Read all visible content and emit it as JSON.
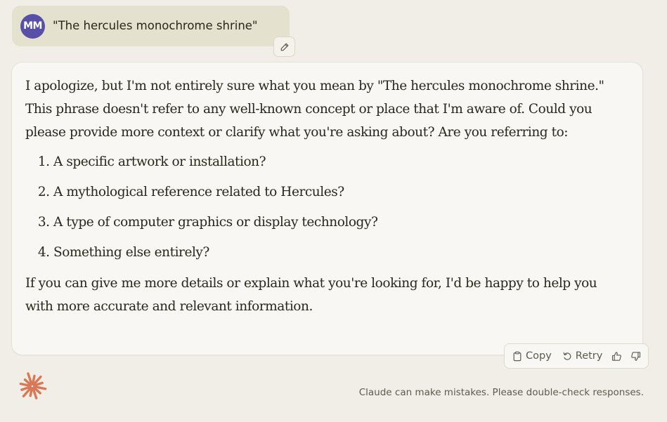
{
  "user_message": {
    "avatar_initials": "MM",
    "text": "\"The hercules monochrome shrine\""
  },
  "assistant_message": {
    "intro": "I apologize, but I'm not entirely sure what you mean by \"The hercules monochrome shrine.\" This phrase doesn't refer to any well-known concept or place that I'm aware of. Could you please provide more context or clarify what you're asking about? Are you referring to:",
    "list_items": [
      "A specific artwork or installation?",
      "A mythological reference related to Hercules?",
      "A type of computer graphics or display technology?",
      "Something else entirely?"
    ],
    "closing": "If you can give me more details or explain what you're looking for, I'd be happy to help you with more accurate and relevant information."
  },
  "actions": {
    "copy_label": "Copy",
    "retry_label": "Retry"
  },
  "footer": {
    "disclaimer": "Claude can make mistakes. Please double-check responses."
  },
  "icons": {
    "edit": "pencil-icon",
    "copy": "clipboard-icon",
    "retry": "undo-icon",
    "thumbs_up": "thumbs-up-icon",
    "thumbs_down": "thumbs-down-icon",
    "logo": "claude-starburst-logo"
  },
  "colors": {
    "background": "#f0eee6",
    "user_bubble": "#e5e1cf",
    "avatar": "#584fa8",
    "card": "#f8f7f3",
    "logo": "#d97757",
    "text": "#29261b",
    "muted_text": "#5d5a4f"
  }
}
